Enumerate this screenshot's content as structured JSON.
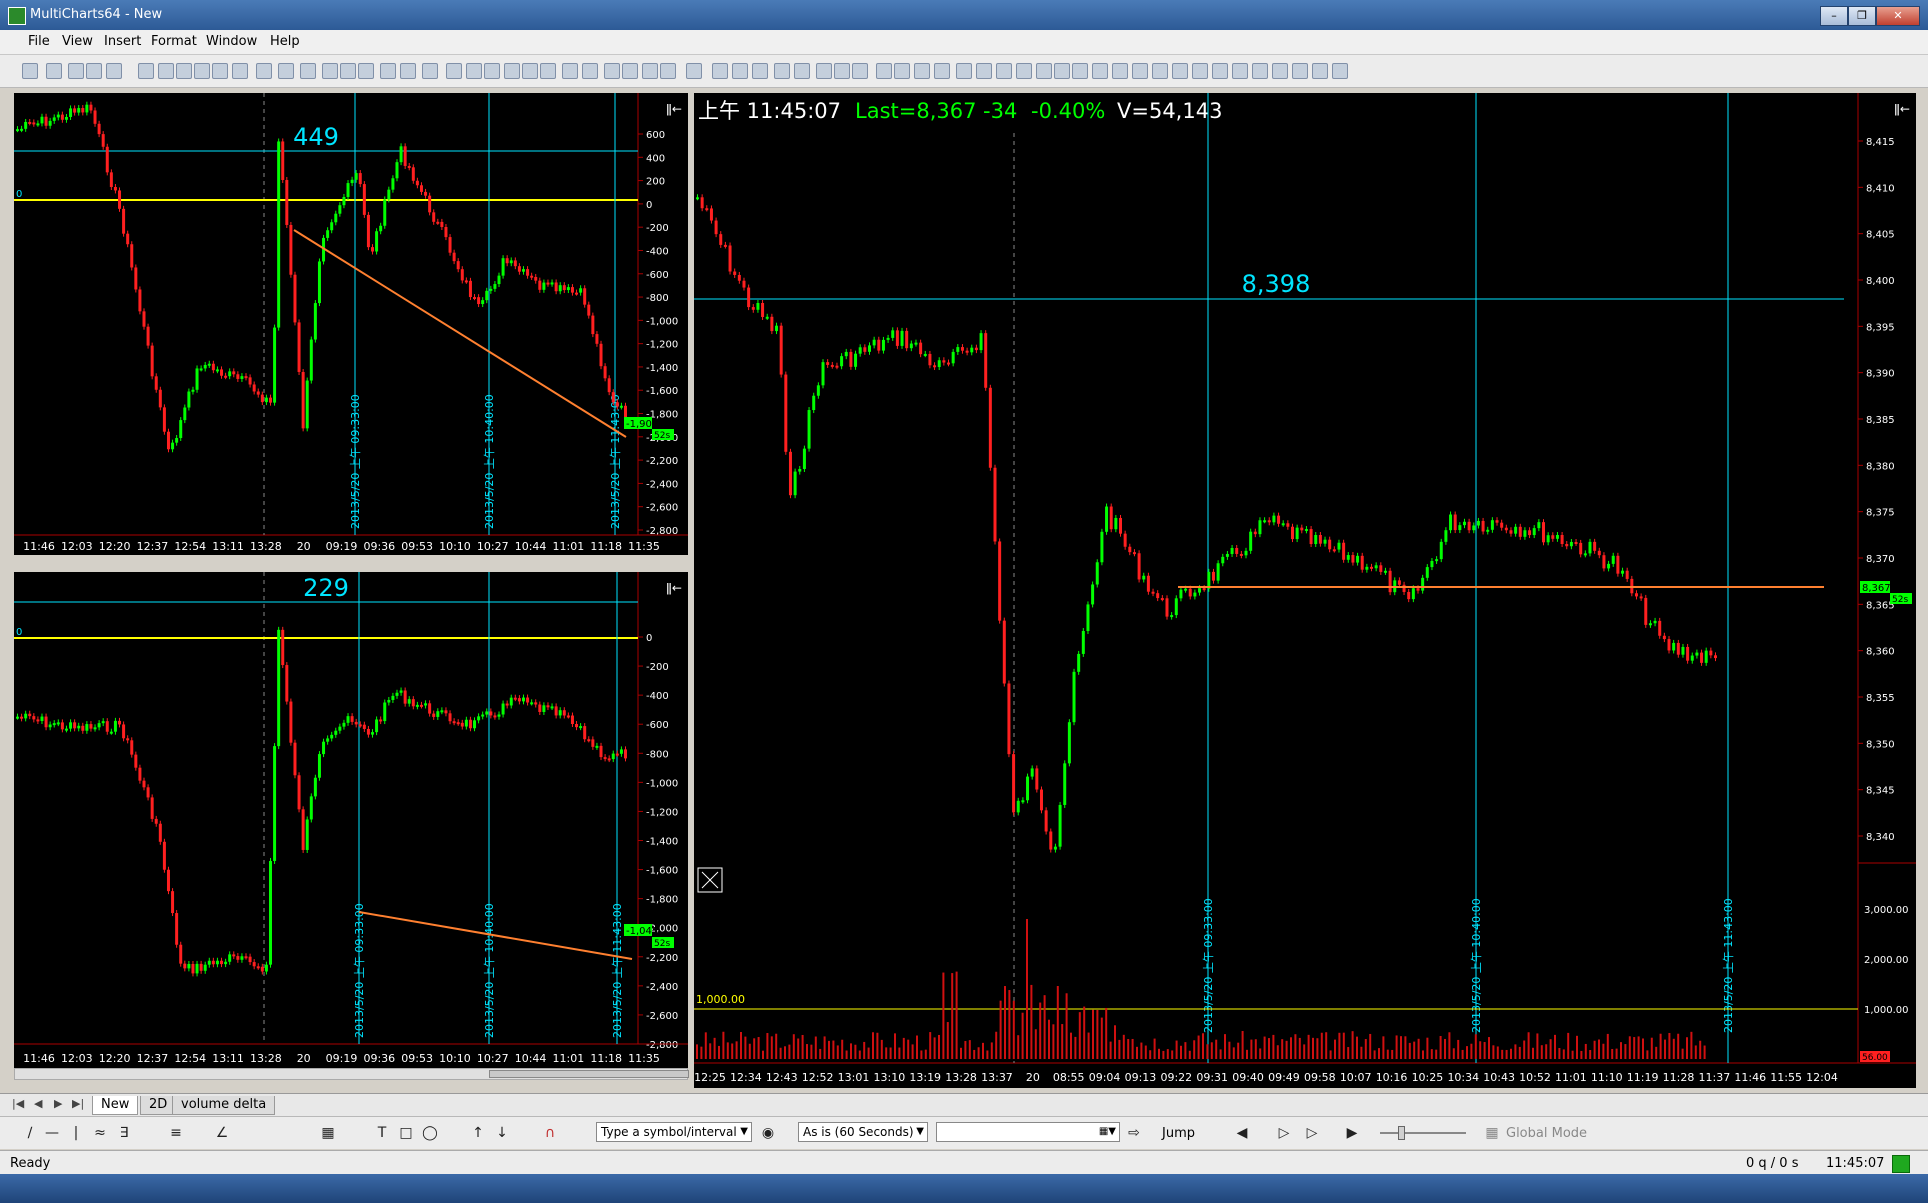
{
  "window": {
    "title": "MultiCharts64 - New"
  },
  "menu": [
    "File",
    "View",
    "Insert",
    "Format",
    "Window",
    "Help"
  ],
  "panels": {
    "top_left": {
      "big_label": "449",
      "zero_label": "0",
      "y_ticks": [
        "600",
        "400",
        "200",
        "0",
        "-200",
        "-400",
        "-600",
        "-800",
        "-1,000",
        "-1,200",
        "-1,400",
        "-1,600",
        "-1,800",
        "-2,000",
        "-2,200",
        "-2,400",
        "-2,600",
        "-2,800"
      ],
      "x_ticks": [
        "11:46",
        "12:03",
        "12:20",
        "12:37",
        "12:54",
        "13:11",
        "13:28",
        "20",
        "09:19",
        "09:36",
        "09:53",
        "10:10",
        "10:27",
        "10:44",
        "11:01",
        "11:18",
        "11:35"
      ],
      "vlines": [
        "2013/5/20 上午 09:33:00",
        "2013/5/20 上午 10:40:00",
        "2013/5/20 上午 11:43:00"
      ],
      "last_tag": "-1,904",
      "countdown": "52s"
    },
    "bottom_left": {
      "big_label": "229",
      "zero_label": "0",
      "y_ticks": [
        "0",
        "-200",
        "-400",
        "-600",
        "-800",
        "-1,000",
        "-1,200",
        "-1,400",
        "-1,600",
        "-1,800",
        "-2,000",
        "-2,200",
        "-2,400",
        "-2,600",
        "-2,800"
      ],
      "x_ticks": [
        "11:46",
        "12:03",
        "12:20",
        "12:37",
        "12:54",
        "13:11",
        "13:28",
        "20",
        "09:19",
        "09:36",
        "09:53",
        "10:10",
        "10:27",
        "10:44",
        "11:01",
        "11:18",
        "11:35"
      ],
      "vlines": [
        "2013/5/20 上午 09:33:00",
        "2013/5/20 上午 10:40:00",
        "2013/5/20 上午 11:43:00"
      ],
      "last_tag": "-1,045",
      "countdown": "52s"
    },
    "main": {
      "status": {
        "time": "上午 11:45:07",
        "last": "Last=8,367",
        "chg": "-34",
        "pct": "-0.40%",
        "vol": "V=54,143"
      },
      "hline_label": "8,398",
      "y_ticks": [
        "8,415",
        "8,410",
        "8,405",
        "8,400",
        "8,395",
        "8,390",
        "8,385",
        "8,380",
        "8,375",
        "8,370",
        "8,365",
        "8,360",
        "8,355",
        "8,350",
        "8,345",
        "8,340"
      ],
      "vol_ticks": [
        "3,000.00",
        "2,000.00",
        "1,000.00"
      ],
      "vol_ref_label": "1,000.00",
      "vol_last": "56.00",
      "x_ticks": [
        "12:25",
        "12:34",
        "12:43",
        "12:52",
        "13:01",
        "13:10",
        "13:19",
        "13:28",
        "13:37",
        "20",
        "08:55",
        "09:04",
        "09:13",
        "09:22",
        "09:31",
        "09:40",
        "09:49",
        "09:58",
        "10:07",
        "10:16",
        "10:25",
        "10:34",
        "10:43",
        "10:52",
        "11:01",
        "11:10",
        "11:19",
        "11:28",
        "11:37",
        "11:46",
        "11:55",
        "12:04"
      ],
      "vlines": [
        "2013/5/20 上午 09:33:00",
        "2013/5/20 上午 10:40:00",
        "2013/5/20 上午 11:43:00"
      ],
      "last_tag": "8,367",
      "countdown": "52s"
    }
  },
  "colors": {
    "up": "#00ff00",
    "down": "#ff2020",
    "cyan": "#00e5ff",
    "yellow": "#ffff00",
    "orange": "#ff8030",
    "bg": "#000000"
  },
  "tabs": [
    "New",
    "2D",
    "volume delta"
  ],
  "drawbar": {
    "symbol_placeholder": "Type a symbol/interval",
    "interval": "As is (60 Seconds)",
    "jump": "Jump",
    "global_mode": "Global Mode"
  },
  "statusbar": {
    "ready": "Ready",
    "queue": "0 q / 0 s",
    "time": "11:45:07"
  }
}
